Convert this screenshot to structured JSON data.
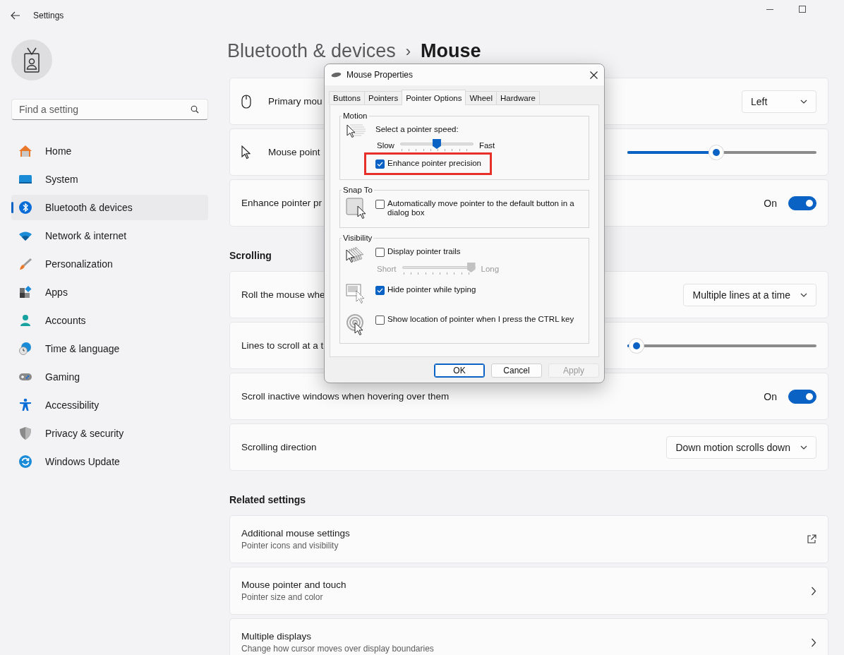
{
  "window": {
    "title": "Settings"
  },
  "search": {
    "placeholder": "Find a setting"
  },
  "sidebar": {
    "items": [
      {
        "label": "Home",
        "selected": false
      },
      {
        "label": "System",
        "selected": false
      },
      {
        "label": "Bluetooth & devices",
        "selected": true
      },
      {
        "label": "Network & internet",
        "selected": false
      },
      {
        "label": "Personalization",
        "selected": false
      },
      {
        "label": "Apps",
        "selected": false
      },
      {
        "label": "Accounts",
        "selected": false
      },
      {
        "label": "Time & language",
        "selected": false
      },
      {
        "label": "Gaming",
        "selected": false
      },
      {
        "label": "Accessibility",
        "selected": false
      },
      {
        "label": "Privacy & security",
        "selected": false
      },
      {
        "label": "Windows Update",
        "selected": false
      }
    ]
  },
  "page": {
    "breadcrumb": "Bluetooth & devices",
    "separator": "›",
    "title": "Mouse"
  },
  "sections": [
    {
      "rows": [
        {
          "kind": "dropdown",
          "label": "Primary mou",
          "value": "Left"
        },
        {
          "kind": "slider",
          "label": "Mouse point",
          "level": 0.47
        },
        {
          "kind": "toggle",
          "label": "Enhance pointer pr",
          "state_text": "On",
          "on": true
        }
      ]
    },
    {
      "heading": "Scrolling",
      "rows": [
        {
          "kind": "dropdown",
          "label": "Roll the mouse whe",
          "value": "Multiple lines at a time"
        },
        {
          "kind": "slider",
          "label": "Lines to scroll at a t",
          "level": 0.05
        },
        {
          "kind": "toggle",
          "label": "Scroll inactive windows when hovering over them",
          "state_text": "On",
          "on": true
        },
        {
          "kind": "dropdown",
          "label": "Scrolling direction",
          "value": "Down motion scrolls down"
        }
      ]
    },
    {
      "heading": "Related settings",
      "rows": [
        {
          "kind": "external",
          "label": "Additional mouse settings",
          "subtitle": "Pointer icons and visibility"
        },
        {
          "kind": "nav",
          "label": "Mouse pointer and touch",
          "subtitle": "Pointer size and color"
        },
        {
          "kind": "nav",
          "label": "Multiple displays",
          "subtitle": "Change how cursor moves over display boundaries"
        }
      ]
    }
  ],
  "dialog": {
    "title": "Mouse Properties",
    "tabs": [
      {
        "label": "Buttons",
        "selected": false
      },
      {
        "label": "Pointers",
        "selected": false
      },
      {
        "label": "Pointer Options",
        "selected": true
      },
      {
        "label": "Wheel",
        "selected": false
      },
      {
        "label": "Hardware",
        "selected": false
      }
    ],
    "groups": [
      {
        "title": "Motion",
        "rows": [
          {
            "items": [
              {
                "kind": "label",
                "text": "Select a pointer speed:"
              },
              {
                "kind": "slider",
                "min_label": "Slow",
                "max_label": "Fast",
                "level": 0.5,
                "disabled": false
              },
              {
                "kind": "checkbox",
                "label": "Enhance pointer precision",
                "checked": true,
                "highlighted": true
              }
            ]
          }
        ]
      },
      {
        "title": "Snap To",
        "rows": [
          {
            "items": [
              {
                "kind": "checkbox",
                "label": "Automatically move pointer to the default button in a dialog box",
                "checked": false,
                "highlighted": false
              }
            ]
          }
        ]
      },
      {
        "title": "Visibility",
        "rows": [
          {
            "items": [
              {
                "kind": "checkbox",
                "label": "Display pointer trails",
                "checked": false,
                "highlighted": false
              },
              {
                "kind": "slider",
                "min_label": "Short",
                "max_label": "Long",
                "level": 1,
                "disabled": true
              }
            ]
          },
          {
            "items": [
              {
                "kind": "checkbox",
                "label": "Hide pointer while typing",
                "checked": true,
                "highlighted": false
              }
            ]
          },
          {
            "items": [
              {
                "kind": "checkbox",
                "label": "Show location of pointer when I press the CTRL key",
                "checked": false,
                "highlighted": false
              }
            ]
          }
        ]
      }
    ],
    "buttons": [
      {
        "label": "OK",
        "default": true,
        "disabled": false
      },
      {
        "label": "Cancel",
        "default": false,
        "disabled": false
      },
      {
        "label": "Apply",
        "default": false,
        "disabled": true
      }
    ]
  }
}
